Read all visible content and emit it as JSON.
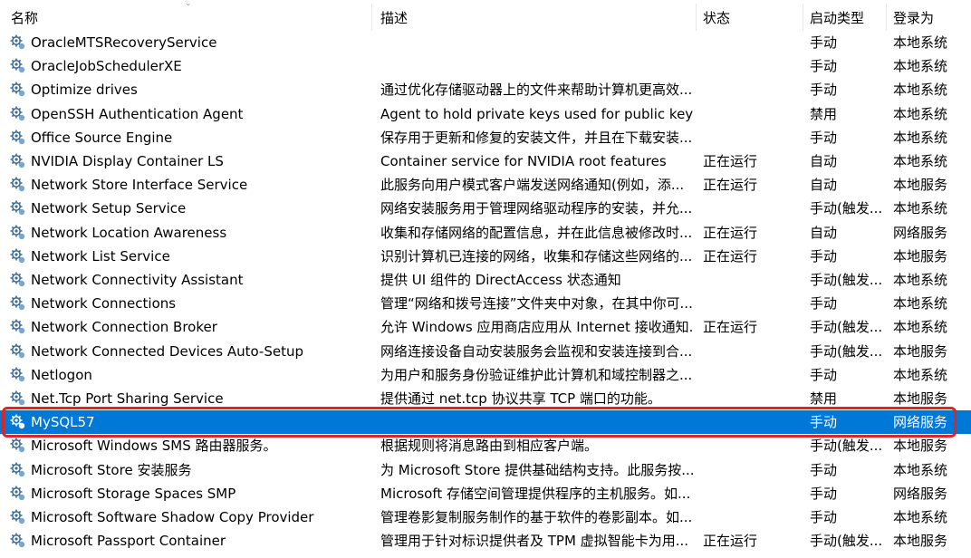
{
  "columns": {
    "name": "名称",
    "description": "描述",
    "status": "状态",
    "startup_type": "启动类型",
    "logon_as": "登录为"
  },
  "colors": {
    "selection": "#0078d7",
    "highlight_box": "#e5231e",
    "gear_icon": "#3f6e99"
  },
  "services": [
    {
      "name": "OracleMTSRecoveryService",
      "description": "",
      "status": "",
      "startup_type": "手动",
      "logon_as": "本地系统",
      "icon": "gear-icon"
    },
    {
      "name": "OracleJobSchedulerXE",
      "description": "",
      "status": "",
      "startup_type": "手动",
      "logon_as": "本地系统",
      "icon": "gear-icon"
    },
    {
      "name": "Optimize drives",
      "description": "通过优化存储驱动器上的文件来帮助计算机更高效...",
      "status": "",
      "startup_type": "手动",
      "logon_as": "本地系统",
      "icon": "gear-icon"
    },
    {
      "name": "OpenSSH Authentication Agent",
      "description": "Agent to hold private keys used for public key au...",
      "status": "",
      "startup_type": "禁用",
      "logon_as": "本地系统",
      "icon": "gear-icon"
    },
    {
      "name": "Office  Source Engine",
      "description": "保存用于更新和修复的安装文件，并且在下载安装...",
      "status": "",
      "startup_type": "手动",
      "logon_as": "本地系统",
      "icon": "gear-icon"
    },
    {
      "name": "NVIDIA Display Container LS",
      "description": "Container service for NVIDIA root features",
      "status": "正在运行",
      "startup_type": "自动",
      "logon_as": "本地系统",
      "icon": "gear-icon"
    },
    {
      "name": "Network Store Interface Service",
      "description": "此服务向用户模式客户端发送网络通知(例如，添...",
      "status": "正在运行",
      "startup_type": "自动",
      "logon_as": "本地服务",
      "icon": "gear-icon"
    },
    {
      "name": "Network Setup Service",
      "description": "网络安装服务用于管理网络驱动程序的安装，并允...",
      "status": "",
      "startup_type": "手动(触发...",
      "logon_as": "本地系统",
      "icon": "gear-icon"
    },
    {
      "name": "Network Location Awareness",
      "description": "收集和存储网络的配置信息，并在此信息被修改时...",
      "status": "正在运行",
      "startup_type": "自动",
      "logon_as": "网络服务",
      "icon": "gear-icon"
    },
    {
      "name": "Network List Service",
      "description": "识别计算机已连接的网络，收集和存储这些网络的...",
      "status": "正在运行",
      "startup_type": "手动",
      "logon_as": "本地服务",
      "icon": "gear-icon"
    },
    {
      "name": "Network Connectivity Assistant",
      "description": "提供 UI 组件的 DirectAccess 状态通知",
      "status": "",
      "startup_type": "手动(触发...",
      "logon_as": "本地系统",
      "icon": "gear-icon"
    },
    {
      "name": "Network Connections",
      "description": "管理“网络和拨号连接”文件夹中对象，在其中你可...",
      "status": "",
      "startup_type": "手动",
      "logon_as": "本地系统",
      "icon": "gear-icon"
    },
    {
      "name": "Network Connection Broker",
      "description": "允许 Windows 应用商店应用从 Internet 接收通知...",
      "status": "正在运行",
      "startup_type": "手动(触发...",
      "logon_as": "本地系统",
      "icon": "gear-icon"
    },
    {
      "name": "Network Connected Devices Auto-Setup",
      "description": "网络连接设备自动安装服务会监视和安装连接到合...",
      "status": "",
      "startup_type": "手动(触发...",
      "logon_as": "本地服务",
      "icon": "gear-icon"
    },
    {
      "name": "Netlogon",
      "description": "为用户和服务身份验证维护此计算机和域控制器之...",
      "status": "",
      "startup_type": "手动",
      "logon_as": "本地系统",
      "icon": "gear-icon"
    },
    {
      "name": "Net.Tcp Port Sharing Service",
      "description": "提供通过 net.tcp 协议共享 TCP 端口的功能。",
      "status": "",
      "startup_type": "禁用",
      "logon_as": "本地服务",
      "icon": "gear-icon"
    },
    {
      "name": "MySQL57",
      "description": "",
      "status": "",
      "startup_type": "手动",
      "logon_as": "网络服务",
      "icon": "gear-icon",
      "selected": true
    },
    {
      "name": "Microsoft Windows SMS 路由器服务。",
      "description": "根据规则将消息路由到相应客户端。",
      "status": "",
      "startup_type": "手动(触发...",
      "logon_as": "本地服务",
      "icon": "gear-icon"
    },
    {
      "name": "Microsoft Store 安装服务",
      "description": "为 Microsoft Store 提供基础结构支持。此服务按...",
      "status": "",
      "startup_type": "手动",
      "logon_as": "本地系统",
      "icon": "gear-icon"
    },
    {
      "name": "Microsoft Storage Spaces SMP",
      "description": "Microsoft 存储空间管理提供程序的主机服务。如...",
      "status": "",
      "startup_type": "手动",
      "logon_as": "网络服务",
      "icon": "gear-icon"
    },
    {
      "name": "Microsoft Software Shadow Copy Provider",
      "description": "管理卷影复制服务制作的基于软件的卷影副本。如...",
      "status": "",
      "startup_type": "手动",
      "logon_as": "本地系统",
      "icon": "gear-icon"
    },
    {
      "name": "Microsoft Passport Container",
      "description": "管理用于针对标识提供者及 TPM 虚拟智能卡为用...",
      "status": "正在运行",
      "startup_type": "手动(触发...",
      "logon_as": "本地服务",
      "icon": "gear-icon"
    }
  ]
}
